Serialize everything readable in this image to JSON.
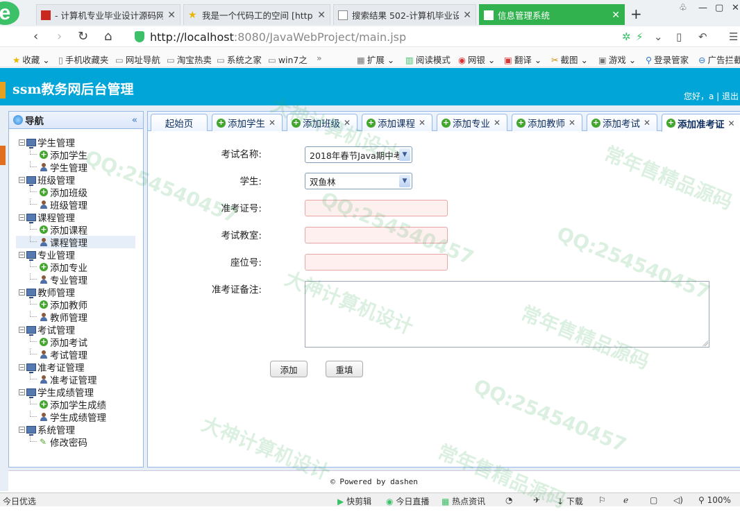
{
  "browser": {
    "tabs": [
      {
        "title": "- 计算机专业毕业设计源码网",
        "active": false
      },
      {
        "title": "我是一个代码工的空间 [http",
        "active": false
      },
      {
        "title": "搜索结果 502-计算机毕业设",
        "active": false
      },
      {
        "title": "信息管理系统",
        "active": true
      }
    ],
    "new_tab": "+",
    "url_host": "http://localhost",
    "url_rest": ":8080/JavaWebProject/main.jsp",
    "bookmarks": [
      "收藏",
      "手机收藏夹",
      "网址导航",
      "淘宝热卖",
      "系统之家",
      "win7之",
      "»",
      "扩展",
      "阅读模式",
      "网银",
      "翻译",
      "截图",
      "游戏",
      "登录管家",
      "广告拦截"
    ],
    "status_left": "今日优选",
    "status_items": [
      "快剪辑",
      "今日直播",
      "热点资讯",
      "下载",
      "100%"
    ]
  },
  "header": {
    "title": "ssm教务网后台管理",
    "user_text": "您好，a  |  退出"
  },
  "sidebar": {
    "title": "导航",
    "collapse": "«",
    "groups": [
      {
        "label": "学生管理",
        "items": [
          "添加学生",
          "学生管理"
        ]
      },
      {
        "label": "班级管理",
        "items": [
          "添加班级",
          "班级管理"
        ]
      },
      {
        "label": "课程管理",
        "items": [
          "添加课程",
          "课程管理"
        ]
      },
      {
        "label": "专业管理",
        "items": [
          "添加专业",
          "专业管理"
        ]
      },
      {
        "label": "教师管理",
        "items": [
          "添加教师",
          "教师管理"
        ]
      },
      {
        "label": "考试管理",
        "items": [
          "添加考试",
          "考试管理"
        ]
      },
      {
        "label": "准考证管理",
        "items": [
          "添加准考证",
          "准考证管理"
        ]
      },
      {
        "label": "学生成绩管理",
        "items": [
          "添加学生成绩",
          "学生成绩管理"
        ]
      },
      {
        "label": "系统管理",
        "items": [
          "修改密码"
        ]
      }
    ]
  },
  "page_tabs": [
    "起始页",
    "添加学生",
    "添加班级",
    "添加课程",
    "添加专业",
    "添加教师",
    "添加考试",
    "添加准考证"
  ],
  "form": {
    "exam_label": "考试名称:",
    "exam_value": "2018年春节Java期中考",
    "student_label": "学生:",
    "student_value": "双鱼林",
    "ticket_label": "准考证号:",
    "room_label": "考试教室:",
    "seat_label": "座位号:",
    "memo_label": "准考证备注:",
    "submit": "添加",
    "reset": "重填"
  },
  "footer": "© Powered by dashen",
  "watermarks": [
    "QQ:254540457",
    "大神计算机设计",
    "常年售精品源码",
    "QQ:254540457",
    "大神计算机设计",
    "常年售精品源码",
    "QQ:254540457",
    "QQ:254540457",
    "常年售精品源码",
    "大神计算机设计"
  ]
}
